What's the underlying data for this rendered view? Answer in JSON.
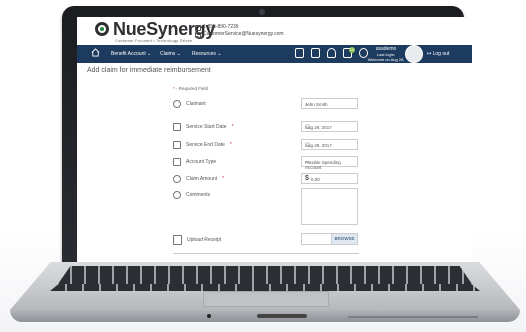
{
  "brand": {
    "name": "NueSynergy",
    "tagline": "Customer Focused • Technology Driven",
    "phone": "1-855-890-7239",
    "email": "CustomerService@Nuesynergy.com"
  },
  "nav": {
    "items": [
      "Benefit Account ⌄",
      "Claims ⌄",
      "Resources ⌄"
    ],
    "badge_count": "10",
    "user_name": "asademo",
    "user_sub1": "Last login:",
    "user_sub2": "Welcome on Aug 28, 2017",
    "logout": "Log out"
  },
  "page": {
    "title": "Add claim for immediate reimbursement",
    "required_note_star": "*",
    "required_note": " - Required Field"
  },
  "form": {
    "claimant_label": "Claimant",
    "claimant_value": "John Smith",
    "start_label": "Service Start Date",
    "start_value": "Aug 29, 2017",
    "end_label": "Service End Date",
    "end_value": "Aug 29, 2017",
    "account_label": "Account Type",
    "account_value": "Flexible Spending Account",
    "amount_label": "Claim Amount",
    "amount_currency": "$",
    "amount_value": "0.00",
    "comments_label": "Comments",
    "upload_label": "Upload Receipt",
    "browse_label": "BROWSE",
    "star": "*"
  },
  "colors": {
    "nav_bg": "#1c3b5e",
    "accent_green": "#1f8a3a",
    "required_red": "#c0392b"
  }
}
